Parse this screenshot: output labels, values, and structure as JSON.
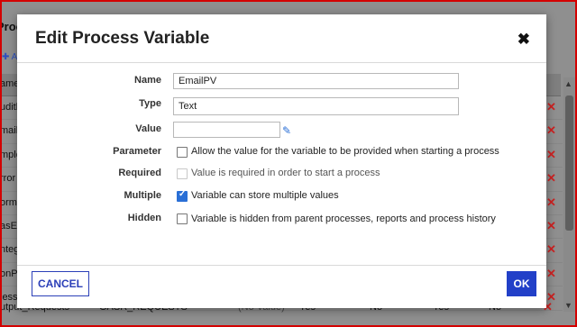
{
  "background": {
    "title_fragment": "Proc",
    "add_fragment": "Ac",
    "header_fragment": "ame",
    "row_fragments": [
      "uditl",
      "mail",
      "mplo",
      "rror",
      "orma",
      "asEr",
      "ntegr",
      "onP",
      "lessa"
    ],
    "delete_glyph": "✕",
    "last_row": {
      "name": "utput_Requests",
      "value": "GASR_REQUESTS",
      "default": "(No Value)",
      "col1": "Yes",
      "col2": "No",
      "col3": "Yes",
      "col4": "No"
    }
  },
  "dialog": {
    "title": "Edit Process Variable",
    "close_glyph": "✖",
    "fields": {
      "name_label": "Name",
      "name_value": "EmailPV",
      "type_label": "Type",
      "type_value": "Text",
      "value_label": "Value",
      "value_value": "",
      "edit_icon": "edit-icon"
    },
    "options": {
      "parameter_label": "Parameter",
      "parameter_text": "Allow the value for the variable to be provided when starting a process",
      "parameter_checked": false,
      "required_label": "Required",
      "required_text": "Value is required in order to start a process",
      "required_checked": false,
      "multiple_label": "Multiple",
      "multiple_text": "Variable can store multiple values",
      "multiple_checked": true,
      "hidden_label": "Hidden",
      "hidden_text": "Variable is hidden from parent processes, reports and process history",
      "hidden_checked": false
    },
    "buttons": {
      "cancel": "CANCEL",
      "ok": "OK"
    }
  },
  "colors": {
    "primary": "#2240c8",
    "checkbox_on": "#2a6fd6",
    "delete": "#cc2222",
    "frame_border": "#d40000"
  }
}
